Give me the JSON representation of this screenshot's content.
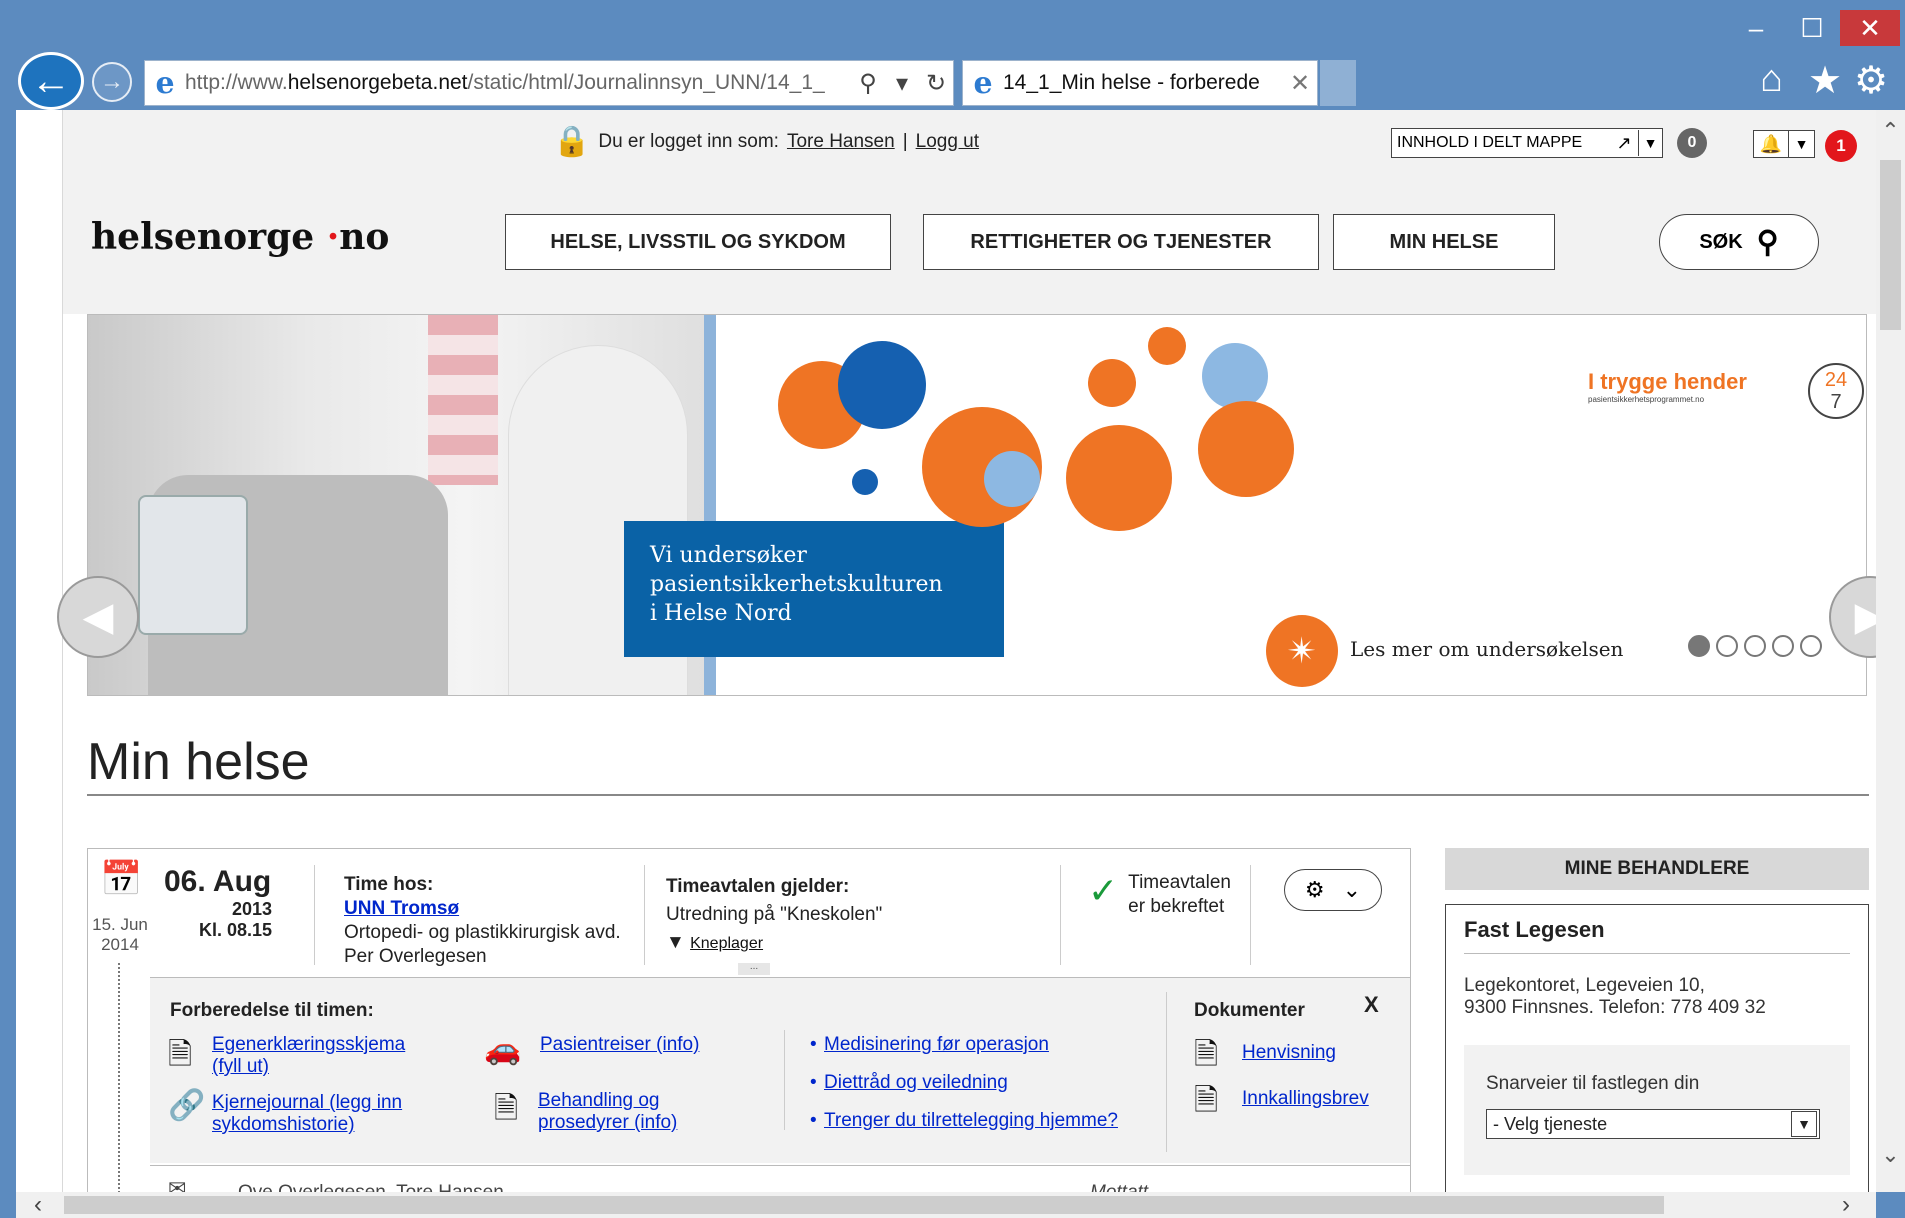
{
  "browser": {
    "url_prefix": "http://www.",
    "url_domain": "helsenorgebeta.net",
    "url_path": "/static/html/Journalinnsyn_UNN/14_1_",
    "tab_title": "14_1_Min helse - forberede"
  },
  "header": {
    "login_text": "Du er logget inn som:",
    "user_name": "Tore Hansen",
    "separator": "|",
    "logout": "Logg ut",
    "shared_folder": "INNHOLD I DELT MAPPE",
    "shared_count": "0",
    "notif_count": "1",
    "logo_main": "helsenorge",
    "logo_dot": "·",
    "logo_tld": "no",
    "nav": [
      "HELSE, LIVSSTIL OG SYKDOM",
      "RETTIGHETER OG TJENESTER",
      "MIN HELSE"
    ],
    "search": "SØK"
  },
  "banner": {
    "headline_lines": [
      "Vi undersøker",
      "pasientsikkerhetskulturen",
      "i Helse Nord"
    ],
    "read_more": "Les mer om undersøkelsen",
    "brand": "I trygge hender",
    "brand_sub": "pasientsikkerhetsprogrammet.no",
    "brand_num_top": "24",
    "brand_num_bottom": "7",
    "active_slide": 1,
    "slide_count": 5
  },
  "page_title": "Min helse",
  "appointment": {
    "prev_date": "15. Jun",
    "prev_year": "2014",
    "date": "06. Aug",
    "year": "2013",
    "time": "Kl. 08.15",
    "time_hos_label": "Time hos:",
    "location": "UNN Tromsø",
    "department": "Ortopedi- og plastikkirurgisk avd.",
    "doctor": "Per Overlegesen",
    "applies_label": "Timeavtalen gjelder:",
    "applies_text": "Utredning på \"Kneskolen\"",
    "tag": "Kneplager",
    "status_line1": "Timeavtalen",
    "status_line2": "er bekreftet",
    "more": "...",
    "prep_heading": "Forberedelse til timen:",
    "links": {
      "egen_1": "Egenerklæringsskjema",
      "egen_2": "(fyll ut)",
      "kjerne_1": "Kjernejournal (legg inn",
      "kjerne_2": "sykdomshistorie)",
      "pasient": "Pasientreiser (info)",
      "behandling_1": "Behandling og",
      "behandling_2": "prosedyrer (info)",
      "medisinering": "Medisinering før operasjon",
      "diett": "Diettråd og veiledning",
      "tilrettelegging": "Trenger du tilrettelegging hjemme?"
    },
    "bullet": "•",
    "docs_heading": "Dokumenter",
    "docs_close": "X",
    "docs": [
      "Henvisning",
      "Innkallingsbrev"
    ],
    "message_from": "Ove Overlegesen, Tore Hansen",
    "message_status": "Mottatt"
  },
  "providers": {
    "heading": "MINE BEHANDLERE",
    "name": "Fast Legesen",
    "address_line1": "Legekontoret, Legeveien 10,",
    "address_line2": "9300 Finnsnes. Telefon: 778 409 32",
    "shortcuts_label": "Snarveier til fastlegen din",
    "select_value": "- Velg tjeneste"
  }
}
